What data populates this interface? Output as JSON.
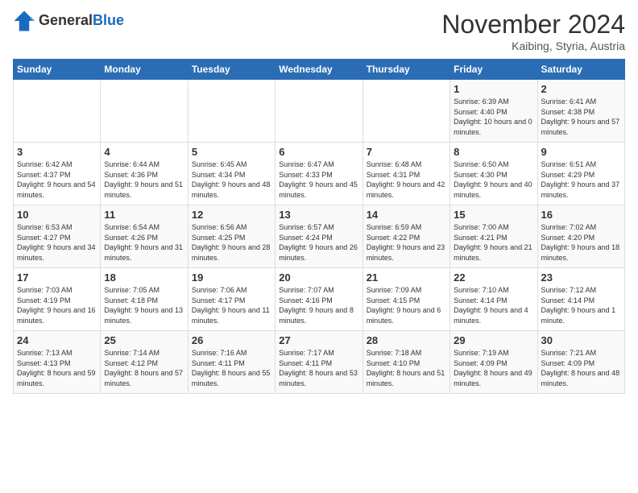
{
  "header": {
    "logo_general": "General",
    "logo_blue": "Blue",
    "month_title": "November 2024",
    "subtitle": "Kaibing, Styria, Austria"
  },
  "days_of_week": [
    "Sunday",
    "Monday",
    "Tuesday",
    "Wednesday",
    "Thursday",
    "Friday",
    "Saturday"
  ],
  "weeks": [
    [
      {
        "day": "",
        "info": ""
      },
      {
        "day": "",
        "info": ""
      },
      {
        "day": "",
        "info": ""
      },
      {
        "day": "",
        "info": ""
      },
      {
        "day": "",
        "info": ""
      },
      {
        "day": "1",
        "info": "Sunrise: 6:39 AM\nSunset: 4:40 PM\nDaylight: 10 hours and 0 minutes."
      },
      {
        "day": "2",
        "info": "Sunrise: 6:41 AM\nSunset: 4:38 PM\nDaylight: 9 hours and 57 minutes."
      }
    ],
    [
      {
        "day": "3",
        "info": "Sunrise: 6:42 AM\nSunset: 4:37 PM\nDaylight: 9 hours and 54 minutes."
      },
      {
        "day": "4",
        "info": "Sunrise: 6:44 AM\nSunset: 4:36 PM\nDaylight: 9 hours and 51 minutes."
      },
      {
        "day": "5",
        "info": "Sunrise: 6:45 AM\nSunset: 4:34 PM\nDaylight: 9 hours and 48 minutes."
      },
      {
        "day": "6",
        "info": "Sunrise: 6:47 AM\nSunset: 4:33 PM\nDaylight: 9 hours and 45 minutes."
      },
      {
        "day": "7",
        "info": "Sunrise: 6:48 AM\nSunset: 4:31 PM\nDaylight: 9 hours and 42 minutes."
      },
      {
        "day": "8",
        "info": "Sunrise: 6:50 AM\nSunset: 4:30 PM\nDaylight: 9 hours and 40 minutes."
      },
      {
        "day": "9",
        "info": "Sunrise: 6:51 AM\nSunset: 4:29 PM\nDaylight: 9 hours and 37 minutes."
      }
    ],
    [
      {
        "day": "10",
        "info": "Sunrise: 6:53 AM\nSunset: 4:27 PM\nDaylight: 9 hours and 34 minutes."
      },
      {
        "day": "11",
        "info": "Sunrise: 6:54 AM\nSunset: 4:26 PM\nDaylight: 9 hours and 31 minutes."
      },
      {
        "day": "12",
        "info": "Sunrise: 6:56 AM\nSunset: 4:25 PM\nDaylight: 9 hours and 28 minutes."
      },
      {
        "day": "13",
        "info": "Sunrise: 6:57 AM\nSunset: 4:24 PM\nDaylight: 9 hours and 26 minutes."
      },
      {
        "day": "14",
        "info": "Sunrise: 6:59 AM\nSunset: 4:22 PM\nDaylight: 9 hours and 23 minutes."
      },
      {
        "day": "15",
        "info": "Sunrise: 7:00 AM\nSunset: 4:21 PM\nDaylight: 9 hours and 21 minutes."
      },
      {
        "day": "16",
        "info": "Sunrise: 7:02 AM\nSunset: 4:20 PM\nDaylight: 9 hours and 18 minutes."
      }
    ],
    [
      {
        "day": "17",
        "info": "Sunrise: 7:03 AM\nSunset: 4:19 PM\nDaylight: 9 hours and 16 minutes."
      },
      {
        "day": "18",
        "info": "Sunrise: 7:05 AM\nSunset: 4:18 PM\nDaylight: 9 hours and 13 minutes."
      },
      {
        "day": "19",
        "info": "Sunrise: 7:06 AM\nSunset: 4:17 PM\nDaylight: 9 hours and 11 minutes."
      },
      {
        "day": "20",
        "info": "Sunrise: 7:07 AM\nSunset: 4:16 PM\nDaylight: 9 hours and 8 minutes."
      },
      {
        "day": "21",
        "info": "Sunrise: 7:09 AM\nSunset: 4:15 PM\nDaylight: 9 hours and 6 minutes."
      },
      {
        "day": "22",
        "info": "Sunrise: 7:10 AM\nSunset: 4:14 PM\nDaylight: 9 hours and 4 minutes."
      },
      {
        "day": "23",
        "info": "Sunrise: 7:12 AM\nSunset: 4:14 PM\nDaylight: 9 hours and 1 minute."
      }
    ],
    [
      {
        "day": "24",
        "info": "Sunrise: 7:13 AM\nSunset: 4:13 PM\nDaylight: 8 hours and 59 minutes."
      },
      {
        "day": "25",
        "info": "Sunrise: 7:14 AM\nSunset: 4:12 PM\nDaylight: 8 hours and 57 minutes."
      },
      {
        "day": "26",
        "info": "Sunrise: 7:16 AM\nSunset: 4:11 PM\nDaylight: 8 hours and 55 minutes."
      },
      {
        "day": "27",
        "info": "Sunrise: 7:17 AM\nSunset: 4:11 PM\nDaylight: 8 hours and 53 minutes."
      },
      {
        "day": "28",
        "info": "Sunrise: 7:18 AM\nSunset: 4:10 PM\nDaylight: 8 hours and 51 minutes."
      },
      {
        "day": "29",
        "info": "Sunrise: 7:19 AM\nSunset: 4:09 PM\nDaylight: 8 hours and 49 minutes."
      },
      {
        "day": "30",
        "info": "Sunrise: 7:21 AM\nSunset: 4:09 PM\nDaylight: 8 hours and 48 minutes."
      }
    ]
  ]
}
